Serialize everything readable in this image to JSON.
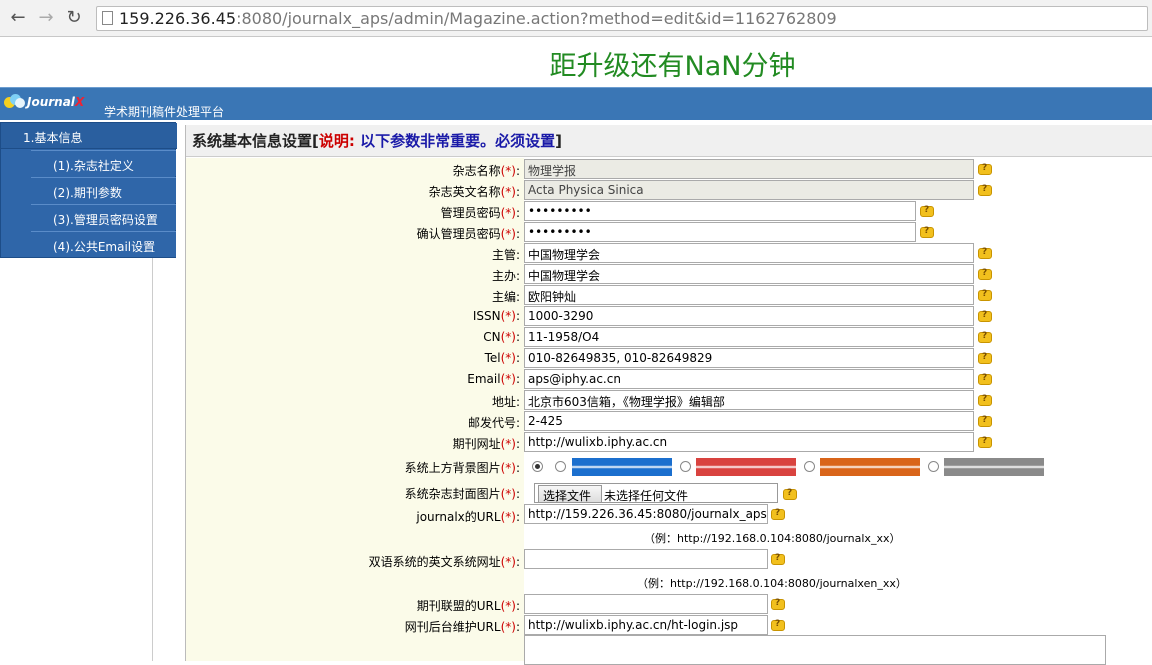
{
  "browser": {
    "url_host": "159.226.36.45",
    "url_rest": ":8080/journalx_aps/admin/Magazine.action?method=edit&id=1162762809"
  },
  "banner": {
    "countdown_pre": "距升级还有",
    "countdown_value": "NaN",
    "countdown_post": "分钟"
  },
  "header": {
    "logo_text": "Journal",
    "logo_x": "X",
    "platform_name": "学术期刊稿件处理平台"
  },
  "sidebar": {
    "head": "1.基本信息",
    "items": [
      {
        "label": "(1).杂志社定义"
      },
      {
        "label": "(2).期刊参数"
      },
      {
        "label": "(3).管理员密码设置"
      },
      {
        "label": "(4).公共Email设置"
      }
    ]
  },
  "main": {
    "title": "系统基本信息设置",
    "note_label": "说明:",
    "note_text": "以下参数非常重要。必须设置",
    "bracket_open": "[",
    "bracket_close": "]"
  },
  "form": {
    "req_mark": "(*)",
    "colon": ":",
    "fields": [
      {
        "label": "杂志名称",
        "required": true,
        "value": "物理学报"
      },
      {
        "label": "杂志英文名称",
        "required": true,
        "value": "Acta Physica Sinica"
      },
      {
        "label": "管理员密码",
        "required": true,
        "value": "•••••••••"
      },
      {
        "label": "确认管理员密码",
        "required": true,
        "value": "•••••••••"
      },
      {
        "label": "主管",
        "required": false,
        "value": "中国物理学会"
      },
      {
        "label": "主办",
        "required": false,
        "value": "中国物理学会"
      },
      {
        "label": "主编",
        "required": false,
        "value": "欧阳钟灿"
      },
      {
        "label": "ISSN",
        "required": true,
        "value": "1000-3290"
      },
      {
        "label": "CN",
        "required": true,
        "value": "11-1958/O4"
      },
      {
        "label": "Tel",
        "required": true,
        "value": "010-82649835, 010-82649829"
      },
      {
        "label": "Email",
        "required": true,
        "value": "aps@iphy.ac.cn"
      },
      {
        "label": "地址",
        "required": false,
        "value": "北京市603信箱，《物理学报》编辑部"
      },
      {
        "label": "邮发代号",
        "required": false,
        "value": "2-425"
      },
      {
        "label": "期刊网址",
        "required": true,
        "value": "http://wulixb.iphy.ac.cn"
      }
    ],
    "bg_label": "系统上方背景图片",
    "bg_colors": [
      "#1b6fce",
      "#d9433f",
      "#d9651a",
      "#8a8a8a"
    ],
    "cover_label": "系统杂志封面图片",
    "file_button": "选择文件",
    "file_status": "未选择任何文件",
    "journalx_url_label": "journalx的URL",
    "journalx_url_value": "http://159.226.36.45:8080/journalx_aps",
    "journalx_url_hint": "（例：http://192.168.0.104:8080/journalx_xx）",
    "en_system_label": "双语系统的英文系统网址",
    "en_system_value": "",
    "en_system_hint": "（例：http://192.168.0.104:8080/journalxen_xx）",
    "alliance_label": "期刊联盟的URL",
    "alliance_value": "",
    "backend_label": "网刊后台维护URL",
    "backend_value": "http://wulixb.iphy.ac.cn/ht-login.jsp"
  }
}
